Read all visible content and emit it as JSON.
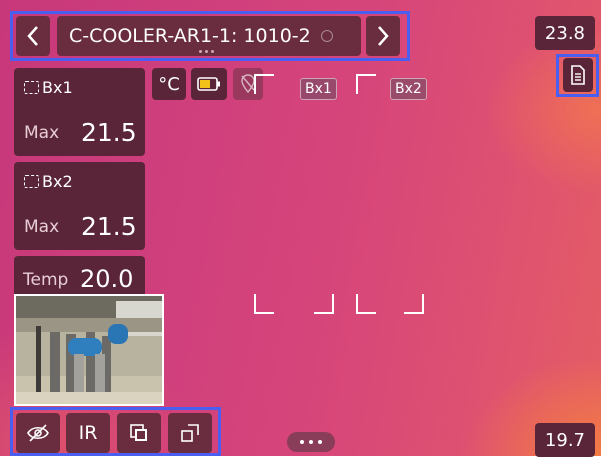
{
  "header": {
    "title": "C-COOLER-AR1-1: 1010-2",
    "back_icon": "chevron-left-icon",
    "forward_icon": "chevron-right-icon"
  },
  "measurements": [
    {
      "label": "Bx1",
      "stat_label": "Max",
      "value": "21.5"
    },
    {
      "label": "Bx2",
      "stat_label": "Max",
      "value": "21.5"
    }
  ],
  "spot": {
    "label": "Temp",
    "value": "20.0"
  },
  "status": {
    "unit": "°C",
    "battery_icon": "battery-icon",
    "gps_icon": "location-off-icon"
  },
  "overlay_labels": {
    "box1": "Bx1",
    "box2": "Bx2"
  },
  "scale": {
    "max": "23.8",
    "min": "19.7"
  },
  "toolbar": {
    "hide_icon": "eye-off-icon",
    "mode_label": "IR",
    "overlay_icon": "picture-in-picture-icon",
    "resize_icon": "resize-icon"
  },
  "colors": {
    "highlight": "#4a5ef0",
    "panel": "#5a2538"
  }
}
